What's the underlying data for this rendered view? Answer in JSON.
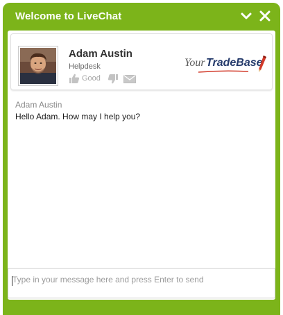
{
  "window": {
    "title": "Welcome to LiveChat",
    "accent_color": "#7cb41a",
    "controls": [
      {
        "name": "minimize",
        "icon": "chevron-down-icon"
      },
      {
        "name": "close",
        "icon": "close-icon"
      }
    ]
  },
  "agent": {
    "name": "Adam Austin",
    "department": "Helpdesk",
    "avatar_icon": "agent-photo",
    "rating": {
      "good_label": "Good",
      "good_icon": "thumbs-up-icon",
      "bad_icon": "thumbs-down-icon",
      "email_icon": "mail-icon"
    }
  },
  "brand": {
    "prefix": "Your",
    "name": "TradeBase",
    "icon": "pencil-icon"
  },
  "messages": [
    {
      "sender": "Adam Austin",
      "text": "Hello Adam. How may I help you?"
    }
  ],
  "composer": {
    "value": "",
    "placeholder": "Type in your message here and press Enter to send"
  }
}
